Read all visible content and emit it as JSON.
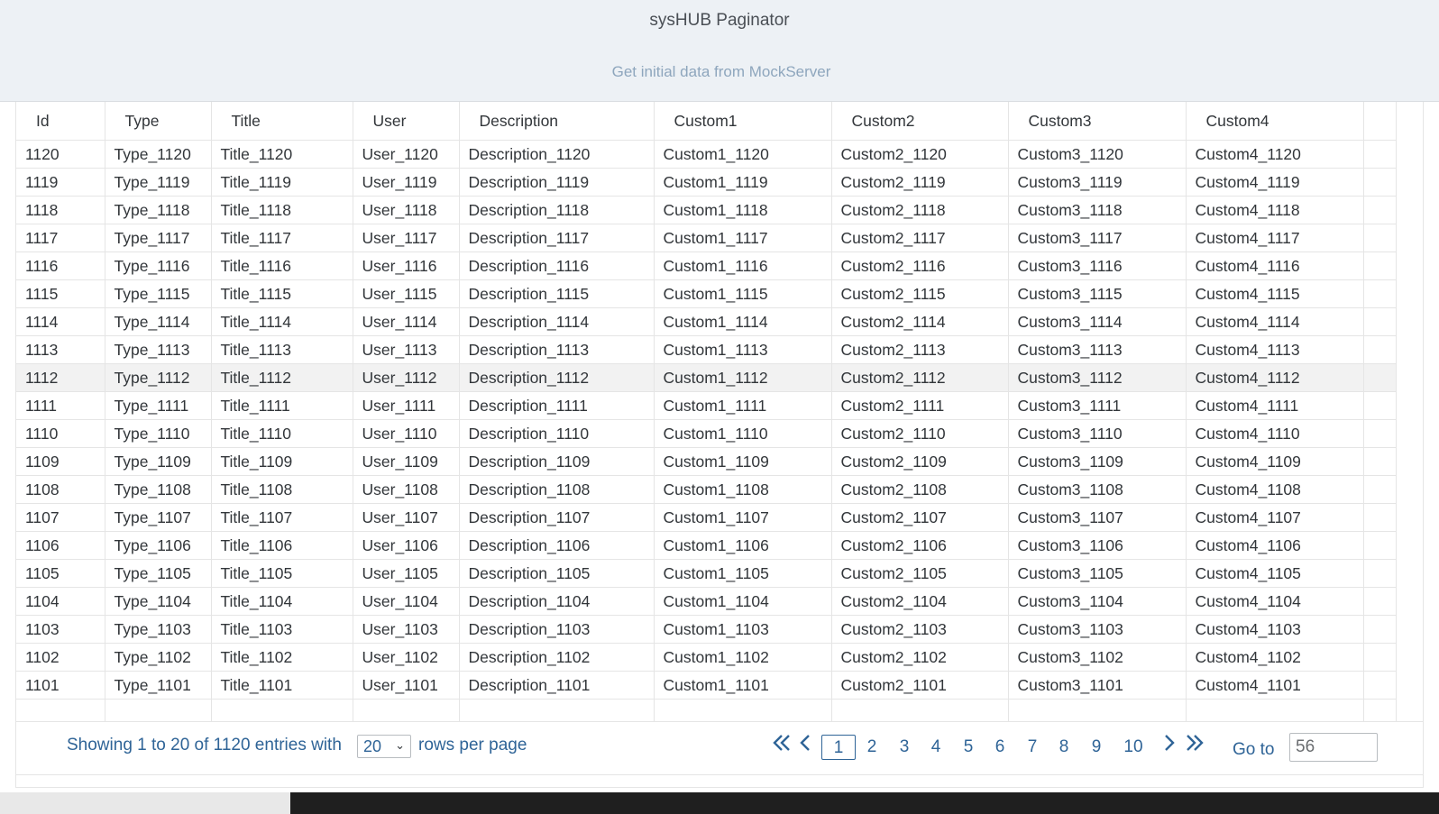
{
  "header": {
    "title": "sysHUB Paginator",
    "link": "Get initial data from MockServer"
  },
  "table": {
    "columns": [
      "Id",
      "Type",
      "Title",
      "User",
      "Description",
      "Custom1",
      "Custom2",
      "Custom3",
      "Custom4"
    ],
    "highlighted_row_id": "1112",
    "rows": [
      [
        "1120",
        "Type_1120",
        "Title_1120",
        "User_1120",
        "Description_1120",
        "Custom1_1120",
        "Custom2_1120",
        "Custom3_1120",
        "Custom4_1120"
      ],
      [
        "1119",
        "Type_1119",
        "Title_1119",
        "User_1119",
        "Description_1119",
        "Custom1_1119",
        "Custom2_1119",
        "Custom3_1119",
        "Custom4_1119"
      ],
      [
        "1118",
        "Type_1118",
        "Title_1118",
        "User_1118",
        "Description_1118",
        "Custom1_1118",
        "Custom2_1118",
        "Custom3_1118",
        "Custom4_1118"
      ],
      [
        "1117",
        "Type_1117",
        "Title_1117",
        "User_1117",
        "Description_1117",
        "Custom1_1117",
        "Custom2_1117",
        "Custom3_1117",
        "Custom4_1117"
      ],
      [
        "1116",
        "Type_1116",
        "Title_1116",
        "User_1116",
        "Description_1116",
        "Custom1_1116",
        "Custom2_1116",
        "Custom3_1116",
        "Custom4_1116"
      ],
      [
        "1115",
        "Type_1115",
        "Title_1115",
        "User_1115",
        "Description_1115",
        "Custom1_1115",
        "Custom2_1115",
        "Custom3_1115",
        "Custom4_1115"
      ],
      [
        "1114",
        "Type_1114",
        "Title_1114",
        "User_1114",
        "Description_1114",
        "Custom1_1114",
        "Custom2_1114",
        "Custom3_1114",
        "Custom4_1114"
      ],
      [
        "1113",
        "Type_1113",
        "Title_1113",
        "User_1113",
        "Description_1113",
        "Custom1_1113",
        "Custom2_1113",
        "Custom3_1113",
        "Custom4_1113"
      ],
      [
        "1112",
        "Type_1112",
        "Title_1112",
        "User_1112",
        "Description_1112",
        "Custom1_1112",
        "Custom2_1112",
        "Custom3_1112",
        "Custom4_1112"
      ],
      [
        "1111",
        "Type_1111",
        "Title_1111",
        "User_1111",
        "Description_1111",
        "Custom1_1111",
        "Custom2_1111",
        "Custom3_1111",
        "Custom4_1111"
      ],
      [
        "1110",
        "Type_1110",
        "Title_1110",
        "User_1110",
        "Description_1110",
        "Custom1_1110",
        "Custom2_1110",
        "Custom3_1110",
        "Custom4_1110"
      ],
      [
        "1109",
        "Type_1109",
        "Title_1109",
        "User_1109",
        "Description_1109",
        "Custom1_1109",
        "Custom2_1109",
        "Custom3_1109",
        "Custom4_1109"
      ],
      [
        "1108",
        "Type_1108",
        "Title_1108",
        "User_1108",
        "Description_1108",
        "Custom1_1108",
        "Custom2_1108",
        "Custom3_1108",
        "Custom4_1108"
      ],
      [
        "1107",
        "Type_1107",
        "Title_1107",
        "User_1107",
        "Description_1107",
        "Custom1_1107",
        "Custom2_1107",
        "Custom3_1107",
        "Custom4_1107"
      ],
      [
        "1106",
        "Type_1106",
        "Title_1106",
        "User_1106",
        "Description_1106",
        "Custom1_1106",
        "Custom2_1106",
        "Custom3_1106",
        "Custom4_1106"
      ],
      [
        "1105",
        "Type_1105",
        "Title_1105",
        "User_1105",
        "Description_1105",
        "Custom1_1105",
        "Custom2_1105",
        "Custom3_1105",
        "Custom4_1105"
      ],
      [
        "1104",
        "Type_1104",
        "Title_1104",
        "User_1104",
        "Description_1104",
        "Custom1_1104",
        "Custom2_1104",
        "Custom3_1104",
        "Custom4_1104"
      ],
      [
        "1103",
        "Type_1103",
        "Title_1103",
        "User_1103",
        "Description_1103",
        "Custom1_1103",
        "Custom2_1103",
        "Custom3_1103",
        "Custom4_1103"
      ],
      [
        "1102",
        "Type_1102",
        "Title_1102",
        "User_1102",
        "Description_1102",
        "Custom1_1102",
        "Custom2_1102",
        "Custom3_1102",
        "Custom4_1102"
      ],
      [
        "1101",
        "Type_1101",
        "Title_1101",
        "User_1101",
        "Description_1101",
        "Custom1_1101",
        "Custom2_1101",
        "Custom3_1101",
        "Custom4_1101"
      ]
    ]
  },
  "footer": {
    "showing_text": "Showing 1 to 20 of 1120 entries with",
    "rows_per_page_value": "20",
    "rows_per_page_suffix": "rows per page",
    "pages": [
      "1",
      "2",
      "3",
      "4",
      "5",
      "6",
      "7",
      "8",
      "9",
      "10"
    ],
    "current_page": "1",
    "first_icon": "double-chevron-left-icon",
    "prev_icon": "chevron-left-icon",
    "next_icon": "chevron-right-icon",
    "last_icon": "double-chevron-right-icon",
    "goto_label": "Go to",
    "goto_value": "56"
  },
  "colors": {
    "header_bg": "#edf1f5",
    "link": "#2f6497",
    "highlight_row": "#f2f2f2"
  }
}
